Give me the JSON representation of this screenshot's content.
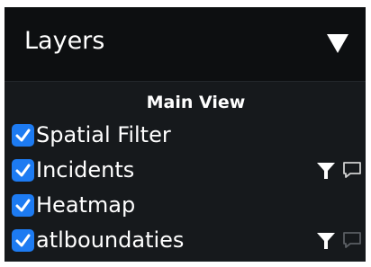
{
  "panel": {
    "title": "Layers",
    "collapse_icon": "triangle-down-icon"
  },
  "section": {
    "title": "Main View"
  },
  "layers": [
    {
      "label": "Spatial Filter",
      "checked": true,
      "has_filter": false,
      "has_comment": false
    },
    {
      "label": "Incidents",
      "checked": true,
      "has_filter": true,
      "has_comment": true,
      "comment_color": "#d0d0d0"
    },
    {
      "label": "Heatmap",
      "checked": true,
      "has_filter": false,
      "has_comment": false
    },
    {
      "label": "atlboundaties",
      "checked": true,
      "has_filter": true,
      "has_comment": true,
      "comment_color": "#5a5e63"
    }
  ],
  "colors": {
    "checkbox": "#1d7bf2",
    "panel_bg": "#16191c",
    "header_bg": "#0d0f11",
    "text": "#ffffff"
  }
}
